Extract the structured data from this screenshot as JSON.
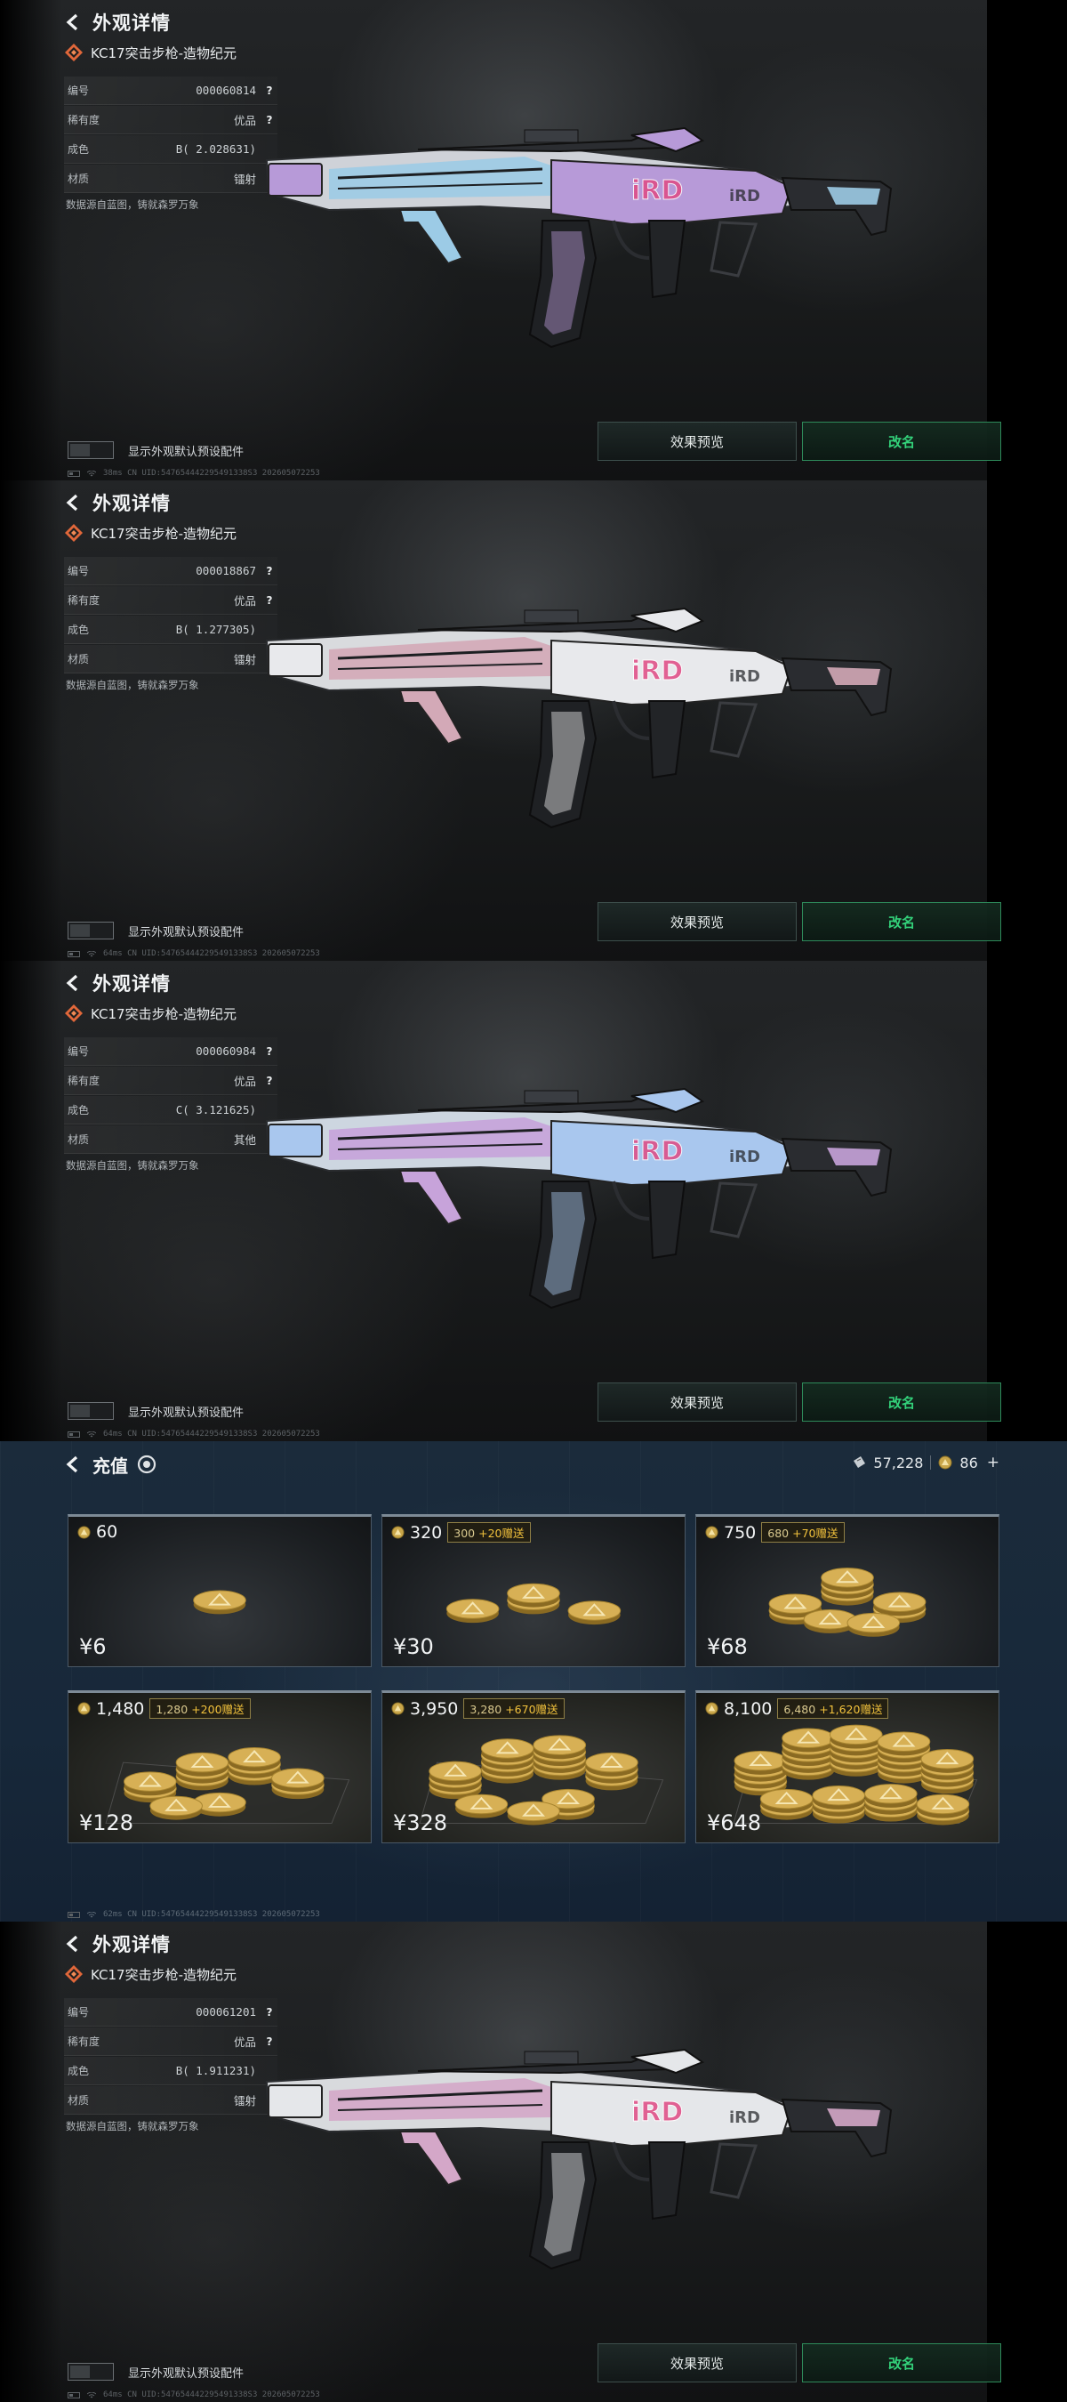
{
  "detail_screens": [
    {
      "header_title": "外观详情",
      "item_name": "KC17突击步枪-造物纪元",
      "attributes": [
        {
          "label": "编号",
          "value": "000060814",
          "help": "?"
        },
        {
          "label": "稀有度",
          "value": "优品",
          "help": "?"
        },
        {
          "label": "成色",
          "value": "B( 2.028631)",
          "help": ""
        },
        {
          "label": "材质",
          "value": "镭射",
          "help": ""
        }
      ],
      "source_note": "数据源自蓝图，铸就森罗万象",
      "toggle_label": "显示外观默认预设配件",
      "preview_button": "效果预览",
      "rename_button": "改名",
      "status": "38ms   CN UID:547654442295491338S3 202605072253",
      "skin_colors": {
        "primary": "#b79ad8",
        "secondary": "#9ccbe6",
        "base": "#cfd2d8"
      }
    },
    {
      "header_title": "外观详情",
      "item_name": "KC17突击步枪-造物纪元",
      "attributes": [
        {
          "label": "编号",
          "value": "000018867",
          "help": "?"
        },
        {
          "label": "稀有度",
          "value": "优品",
          "help": "?"
        },
        {
          "label": "成色",
          "value": "B( 1.277305)",
          "help": ""
        },
        {
          "label": "材质",
          "value": "镭射",
          "help": ""
        }
      ],
      "source_note": "数据源自蓝图，铸就森罗万象",
      "toggle_label": "显示外观默认预设配件",
      "preview_button": "效果预览",
      "rename_button": "改名",
      "status": "64ms   CN UID:547654442295491338S3 202605072253",
      "skin_colors": {
        "primary": "#e8e9ec",
        "secondary": "#d3a9b7",
        "base": "#d9dbde"
      }
    },
    {
      "header_title": "外观详情",
      "item_name": "KC17突击步枪-造物纪元",
      "attributes": [
        {
          "label": "编号",
          "value": "000060984",
          "help": "?"
        },
        {
          "label": "稀有度",
          "value": "优品",
          "help": "?"
        },
        {
          "label": "成色",
          "value": "C( 3.121625)",
          "help": ""
        },
        {
          "label": "材质",
          "value": "其他",
          "help": ""
        }
      ],
      "source_note": "数据源自蓝图，铸就森罗万象",
      "toggle_label": "显示外观默认预设配件",
      "preview_button": "效果预览",
      "rename_button": "改名",
      "status": "64ms   CN UID:547654442295491338S3 202605072253",
      "skin_colors": {
        "primary": "#a9c7ee",
        "secondary": "#c7a3da",
        "base": "#cdd6e0"
      }
    }
  ],
  "recharge": {
    "title": "充值",
    "tickets": "57,228",
    "coins": "86",
    "plus": "+",
    "packs": [
      {
        "amount": "60",
        "bonus_base": "",
        "bonus_extra": "",
        "price": "¥6",
        "tier": 1
      },
      {
        "amount": "320",
        "bonus_base": "300",
        "bonus_extra": "+20赠送",
        "price": "¥30",
        "tier": 2
      },
      {
        "amount": "750",
        "bonus_base": "680",
        "bonus_extra": "+70赠送",
        "price": "¥68",
        "tier": 3
      },
      {
        "amount": "1,480",
        "bonus_base": "1,280",
        "bonus_extra": "+200赠送",
        "price": "¥128",
        "tier": 4
      },
      {
        "amount": "3,950",
        "bonus_base": "3,280",
        "bonus_extra": "+670赠送",
        "price": "¥328",
        "tier": 5
      },
      {
        "amount": "8,100",
        "bonus_base": "6,480",
        "bonus_extra": "+1,620赠送",
        "price": "¥648",
        "tier": 6
      }
    ],
    "status": "62ms   CN UID:547654442295491338S3 202605072253"
  },
  "detail_last": {
    "header_title": "外观详情",
    "item_name": "KC17突击步枪-造物纪元",
    "attributes": [
      {
        "label": "编号",
        "value": "000061201",
        "help": "?"
      },
      {
        "label": "稀有度",
        "value": "优品",
        "help": "?"
      },
      {
        "label": "成色",
        "value": "B( 1.911231)",
        "help": ""
      },
      {
        "label": "材质",
        "value": "镭射",
        "help": ""
      }
    ],
    "source_note": "数据源自蓝图，铸就森罗万象",
    "toggle_label": "显示外观默认预设配件",
    "preview_button": "效果预览",
    "rename_button": "改名",
    "status": "64ms   CN UID:547654442295491338S3 202605072253",
    "skin_colors": {
      "primary": "#e5e7ea",
      "secondary": "#d4a7c8",
      "base": "#d8dadd"
    }
  }
}
